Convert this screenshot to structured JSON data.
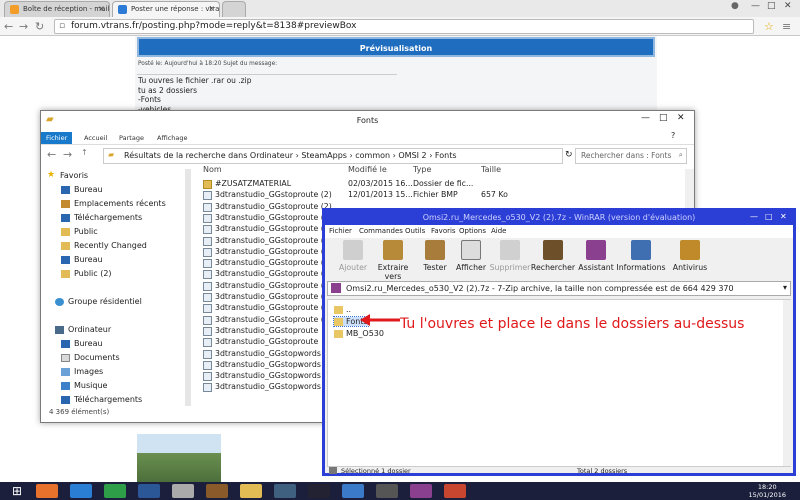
{
  "browser": {
    "tabs": [
      {
        "label": "Boîte de réception - mail",
        "icon": "mail-icon"
      },
      {
        "label": "Poster une réponse : vtrans",
        "icon": "vtrans-icon"
      }
    ],
    "url": "forum.vtrans.fr/posting.php?mode=reply&t=8138#previewBox",
    "window_controls": [
      "user-icon",
      "minimize-icon",
      "maximize-icon",
      "close-icon"
    ]
  },
  "forum": {
    "preview_title": "Prévisualisation",
    "post_meta": "Posté le: Aujourd'hui à 18:20    Sujet du message:",
    "lines": [
      "Tu ouvres le fichier .rar ou .zip",
      "tu as 2 dossiers",
      "-Fonts",
      "-vehicles"
    ]
  },
  "explorer": {
    "title": "Fonts",
    "ribbon_tabs": [
      "Fichier",
      "Accueil",
      "Partage",
      "Affichage"
    ],
    "breadcrumb": "Résultats de la recherche dans Ordinateur  ›  SteamApps  ›  common  ›  OMSI 2  ›  Fonts",
    "search_placeholder": "Rechercher dans : Fonts",
    "nav": {
      "favorites_label": "Favoris",
      "favorites": [
        "Bureau",
        "Emplacements récents",
        "Téléchargements",
        "Public",
        "Recently Changed",
        "Bureau",
        "Public (2)"
      ],
      "homegroup": "Groupe résidentiel",
      "computer_label": "Ordinateur",
      "computer": [
        "Bureau",
        "Documents",
        "Images",
        "Musique",
        "Téléchargements"
      ]
    },
    "columns": [
      "Nom",
      "Modifié le",
      "Type",
      "Taille"
    ],
    "rows": [
      {
        "name": "#ZUSATZMATERIAL",
        "date": "02/03/2015 16...",
        "type": "Dossier de fic...",
        "size": "",
        "folder": true
      },
      {
        "name": "3dtranstudio_GGstoproute (2)",
        "date": "12/01/2013 15...",
        "type": "Fichier BMP",
        "size": "657 Ko"
      },
      {
        "name": "3dtranstudio_GGstoproute (2)",
        "date": "",
        "type": "",
        "size": ""
      },
      {
        "name": "3dtranstudio_GGstoproute (3)",
        "date": "",
        "type": "",
        "size": ""
      },
      {
        "name": "3dtranstudio_GGstoproute (3)",
        "date": "",
        "type": "",
        "size": ""
      },
      {
        "name": "3dtranstudio_GGstoproute (4)",
        "date": "",
        "type": "",
        "size": ""
      },
      {
        "name": "3dtranstudio_GGstoproute (4)",
        "date": "",
        "type": "",
        "size": ""
      },
      {
        "name": "3dtranstudio_GGstoproute (5)",
        "date": "",
        "type": "",
        "size": ""
      },
      {
        "name": "3dtranstudio_GGstoproute (5)",
        "date": "",
        "type": "",
        "size": ""
      },
      {
        "name": "3dtranstudio_GGstoproute (6)",
        "date": "",
        "type": "",
        "size": ""
      },
      {
        "name": "3dtranstudio_GGstoproute (6)",
        "date": "",
        "type": "",
        "size": ""
      },
      {
        "name": "3dtranstudio_GGstoproute (7)",
        "date": "",
        "type": "",
        "size": ""
      },
      {
        "name": "3dtranstudio_GGstoproute (7)",
        "date": "",
        "type": "",
        "size": ""
      },
      {
        "name": "3dtranstudio_GGstoproute",
        "date": "",
        "type": "",
        "size": ""
      },
      {
        "name": "3dtranstudio_GGstoproute",
        "date": "",
        "type": "",
        "size": ""
      },
      {
        "name": "3dtranstudio_GGstopwords (2)",
        "date": "",
        "type": "",
        "size": ""
      },
      {
        "name": "3dtranstudio_GGstopwords (2)",
        "date": "",
        "type": "",
        "size": ""
      },
      {
        "name": "3dtranstudio_GGstopwords (3)",
        "date": "",
        "type": "",
        "size": ""
      },
      {
        "name": "3dtranstudio_GGstopwords (3)",
        "date": "",
        "type": "",
        "size": ""
      }
    ],
    "status": "4 369 élément(s)"
  },
  "winrar": {
    "title": "Omsi2.ru_Mercedes_o530_V2 (2).7z - WinRAR (version d'évaluation)",
    "menu": [
      "Fichier",
      "Commandes",
      "Outils",
      "Favoris",
      "Options",
      "Aide"
    ],
    "toolbar": [
      {
        "label": "Ajouter",
        "icon": "add-icon",
        "disabled": true
      },
      {
        "label": "Extraire vers",
        "icon": "extract-icon"
      },
      {
        "label": "Tester",
        "icon": "test-icon"
      },
      {
        "label": "Afficher",
        "icon": "view-icon"
      },
      {
        "label": "Supprimer",
        "icon": "delete-icon",
        "disabled": true
      },
      {
        "label": "Rechercher",
        "icon": "find-icon"
      },
      {
        "label": "Assistant",
        "icon": "wizard-icon"
      },
      {
        "label": "Informations",
        "icon": "info-icon"
      },
      {
        "label": "Antivirus",
        "icon": "antivirus-icon"
      }
    ],
    "path": "Omsi2.ru_Mercedes_o530_V2 (2).7z - 7-Zip archive, la taille non compressée est de 664 429 370",
    "entries": [
      "..",
      "Fonts",
      "MB_O530"
    ],
    "status_left": "Sélectionné 1 dossier",
    "status_right": "Total 2 dossiers"
  },
  "annotation": "Tu l'ouvres et place le dans le dossiers au-dessus",
  "taskbar": {
    "time": "18:20",
    "date": "15/01/2016",
    "apps": [
      "start-icon",
      "firefox-icon",
      "ie-icon",
      "chrome-icon",
      "word-icon",
      "gear-icon",
      "game-icon",
      "folder-icon",
      "bus-icon",
      "steam-icon",
      "mail-icon",
      "truck-icon",
      "winrar-icon",
      "flag-icon"
    ]
  },
  "colors": {
    "winrar_border": "#2b3ed6",
    "forum_header": "#1e6dbf",
    "annotation": "#e0191b",
    "taskbar": "#1b1f3b"
  }
}
